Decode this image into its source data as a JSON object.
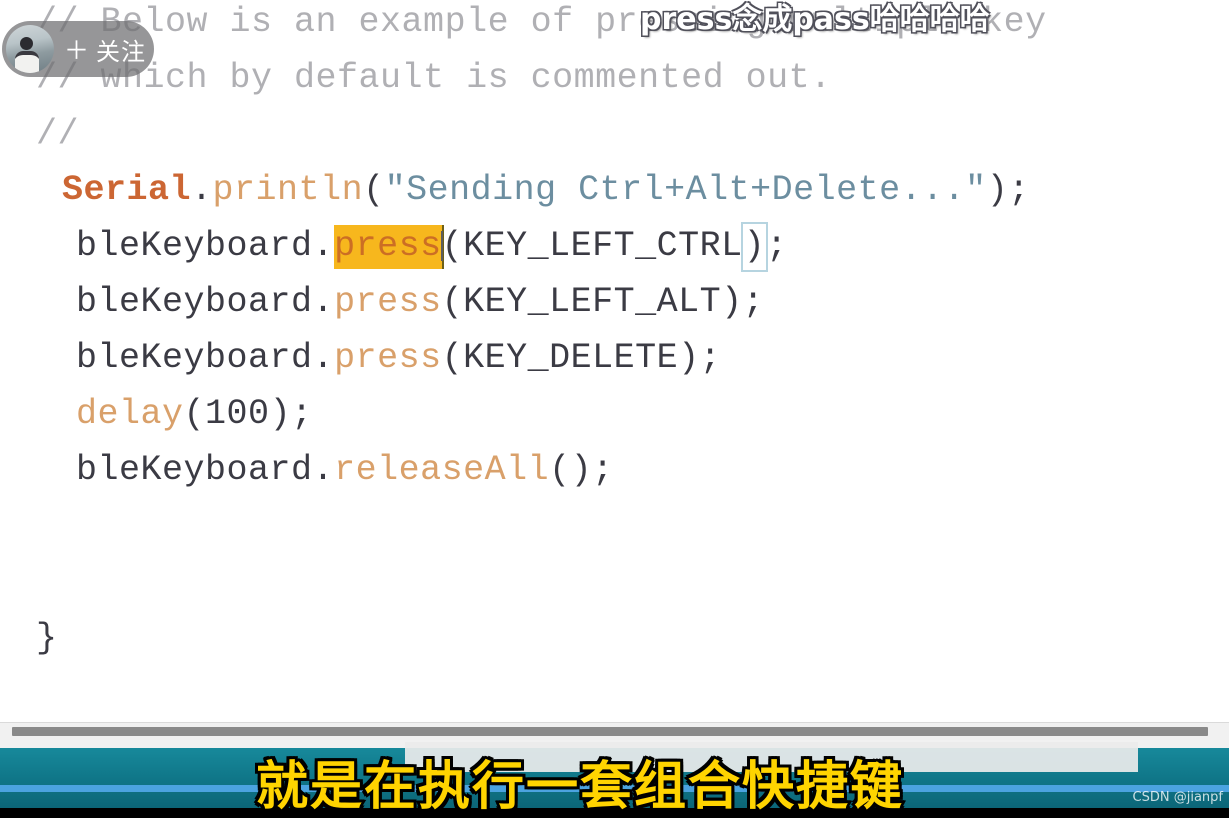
{
  "editor": {
    "background_color": "#ffffff",
    "font_size_px": 35,
    "lines": [
      {
        "id": "comment-1",
        "text": "// Below is an example of pressing multiple key",
        "kind": "comment"
      },
      {
        "id": "comment-2",
        "text": "// which by default is commented out.",
        "kind": "comment"
      },
      {
        "id": "comment-3",
        "text": "//",
        "kind": "comment"
      },
      {
        "id": "serial-println",
        "kind": "code",
        "class_token": "Serial",
        "dot": ".",
        "method_token": "println",
        "open_paren": "(",
        "string_token": "\"Sending Ctrl+Alt+Delete...\"",
        "close_paren": ")",
        "semicolon": ";"
      },
      {
        "id": "press-ctrl",
        "kind": "code",
        "object_token": "bleKeyboard",
        "dot": ".",
        "selected_method": "press",
        "open_paren": "(",
        "arg": "KEY_LEFT_CTRL",
        "close_paren": ")",
        "semicolon": ";"
      },
      {
        "id": "press-alt",
        "kind": "code",
        "object_token": "bleKeyboard",
        "dot": ".",
        "method_token": "press",
        "open_paren": "(",
        "arg": "KEY_LEFT_ALT",
        "close_paren": ")",
        "semicolon": ";"
      },
      {
        "id": "press-delete",
        "kind": "code",
        "object_token": "bleKeyboard",
        "dot": ".",
        "method_token": "press",
        "open_paren": "(",
        "arg": "KEY_DELETE",
        "close_paren": ")",
        "semicolon": ";"
      },
      {
        "id": "delay-call",
        "kind": "code",
        "method_token": "delay",
        "open_paren": "(",
        "arg": "100",
        "close_paren": ")",
        "semicolon": ";"
      },
      {
        "id": "release-all",
        "kind": "code",
        "object_token": "bleKeyboard",
        "dot": ".",
        "method_token": "releaseAll",
        "open_paren": "(",
        "arg": "",
        "close_paren": ")",
        "semicolon": ";"
      },
      {
        "id": "closing-brace",
        "kind": "code",
        "text": "}"
      }
    ],
    "selection": {
      "token": "press",
      "background_color": "#f7b71d",
      "text_color": "#cc6e24"
    },
    "bracket_match": {
      "token": ")",
      "outline_color": "#b6d4e0"
    },
    "syntax_colors": {
      "comment": "#b0b0b4",
      "class": "#cc6633",
      "method": "#d9a06a",
      "string": "#6c8ea0",
      "plain": "#3b3b44"
    }
  },
  "scrollbar": {
    "orientation": "horizontal",
    "track_color": "#f1f1f1",
    "thumb_color": "#8a8a8a"
  },
  "player": {
    "bar_color": "#0f7587",
    "progress_line_color": "#4ba3e0",
    "progress_percent": 100
  },
  "overlay": {
    "comment_text": "press念成pass哈哈哈哈",
    "caption_text": "就是在执行一套组合快捷键",
    "caption_color": "#ffd400",
    "caption_outline_color": "#000000"
  },
  "follow_widget": {
    "plus_icon": "＋",
    "label": "关注"
  },
  "watermark": {
    "text": "CSDN @jianpf"
  }
}
